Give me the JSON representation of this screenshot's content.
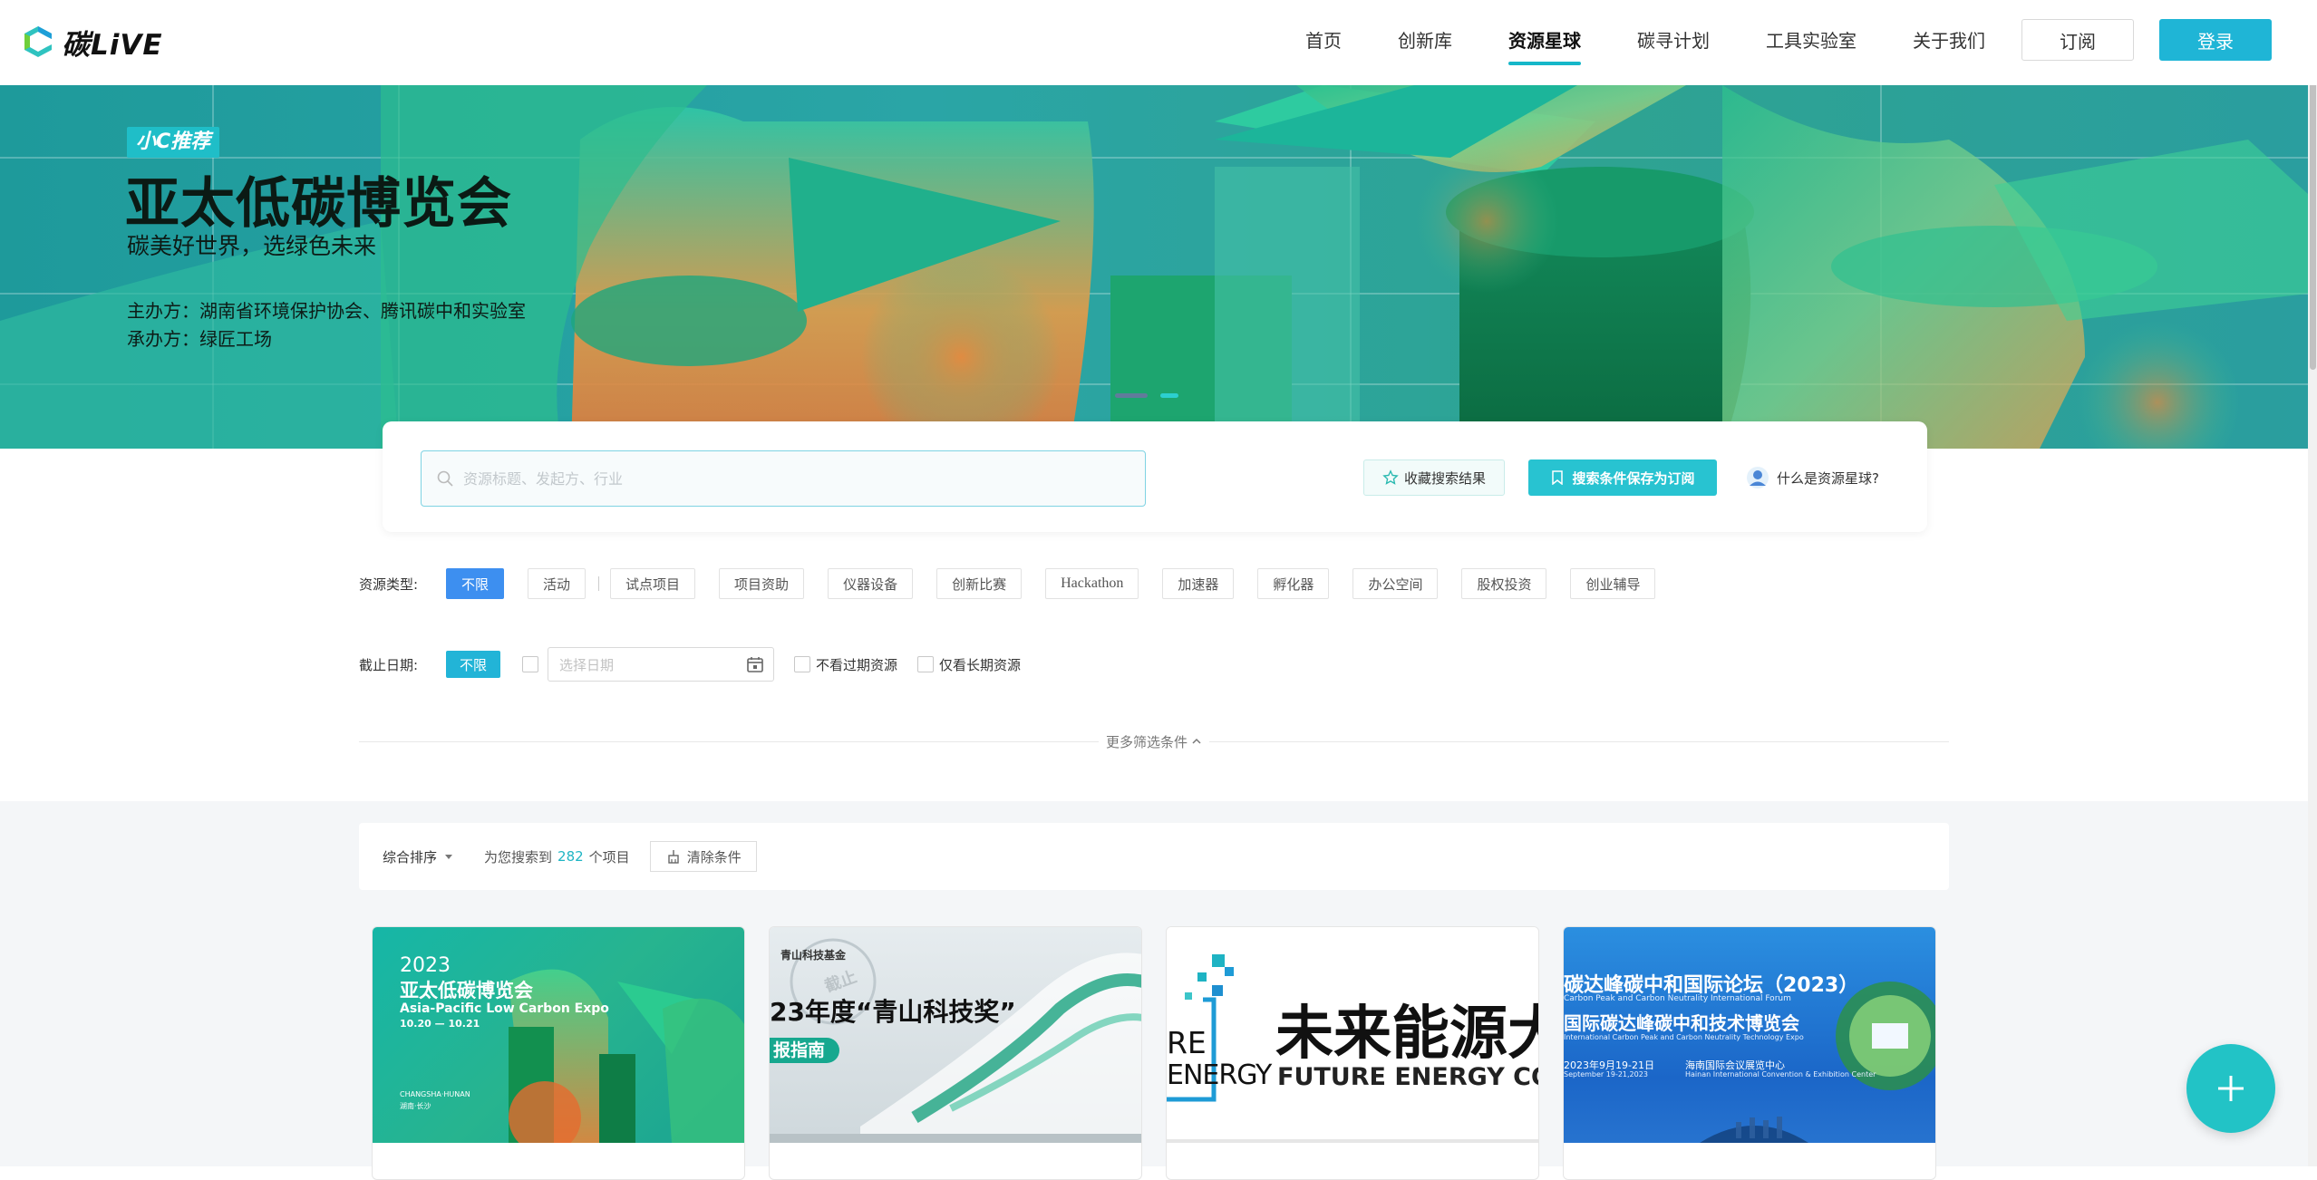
{
  "header": {
    "logo_text": "碳LiVE",
    "nav": [
      "首页",
      "创新库",
      "资源星球",
      "碳寻计划",
      "工具实验室",
      "关于我们"
    ],
    "active_nav": "资源星球",
    "subscribe_label": "订阅",
    "login_label": "登录"
  },
  "banner": {
    "badge": "小C推荐",
    "title": "亚太低碳博览会",
    "subtitle": "碳美好世界，选绿色未来",
    "organizer": "主办方：湖南省环境保护协会、腾讯碳中和实验室",
    "co_organizer": "承办方：绿匠工场"
  },
  "search": {
    "placeholder": "资源标题、发起方、行业",
    "collect_label": "收藏搜索结果",
    "save_label": "搜索条件保存为订阅",
    "what_is_label": "什么是资源星球?"
  },
  "filters": {
    "type_label": "资源类型:",
    "types": [
      "不限",
      "活动",
      "试点项目",
      "项目资助",
      "仪器设备",
      "创新比赛",
      "Hackathon",
      "加速器",
      "孵化器",
      "办公空间",
      "股权投资",
      "创业辅导"
    ],
    "date_label": "截止日期:",
    "date_unlimited": "不限",
    "date_placeholder": "选择日期",
    "hide_expired": "不看过期资源",
    "only_long_term": "仅看长期资源",
    "more_label": "更多筛选条件"
  },
  "results": {
    "sort_label": "综合排序",
    "count_prefix": "为您搜索到",
    "count": "282",
    "count_suffix": "个项目",
    "clear_label": "清除条件"
  },
  "cards": [
    {
      "year": "2023",
      "title": "亚太低碳博览会",
      "en": "Asia-Pacific Low Carbon Expo",
      "dates": "10.20 — 10.21",
      "city": "CHANGSHA·HUNAN",
      "city_cn": "湖南·长沙"
    },
    {
      "brand": "青山科技基金",
      "headline": "23年度“青山科技奖”",
      "tag": "报指南",
      "stamp": "截止"
    },
    {
      "big": "未来能源大",
      "en": "FUTURE ENERGY CONV",
      "side1": "RE",
      "side2": "ENERGY"
    },
    {
      "line1": "碳达峰碳中和国际论坛（2023）",
      "line1_en": "Carbon Peak and Carbon Neutrality International Forum",
      "line2": "国际碳达峰碳中和技术博览会",
      "line2_en": "International Carbon Peak and Carbon Neutrality Technology Expo",
      "date": "2023年9月19-21日",
      "date_en": "September 19-21,2023",
      "venue": "海南国际会议展览中心",
      "venue_en": "Hainan International Convention & Exhibition Center"
    }
  ],
  "colors": {
    "accent": "#1fb5d6",
    "primary_blue": "#3d8ff0",
    "teal": "#22c3c6"
  }
}
